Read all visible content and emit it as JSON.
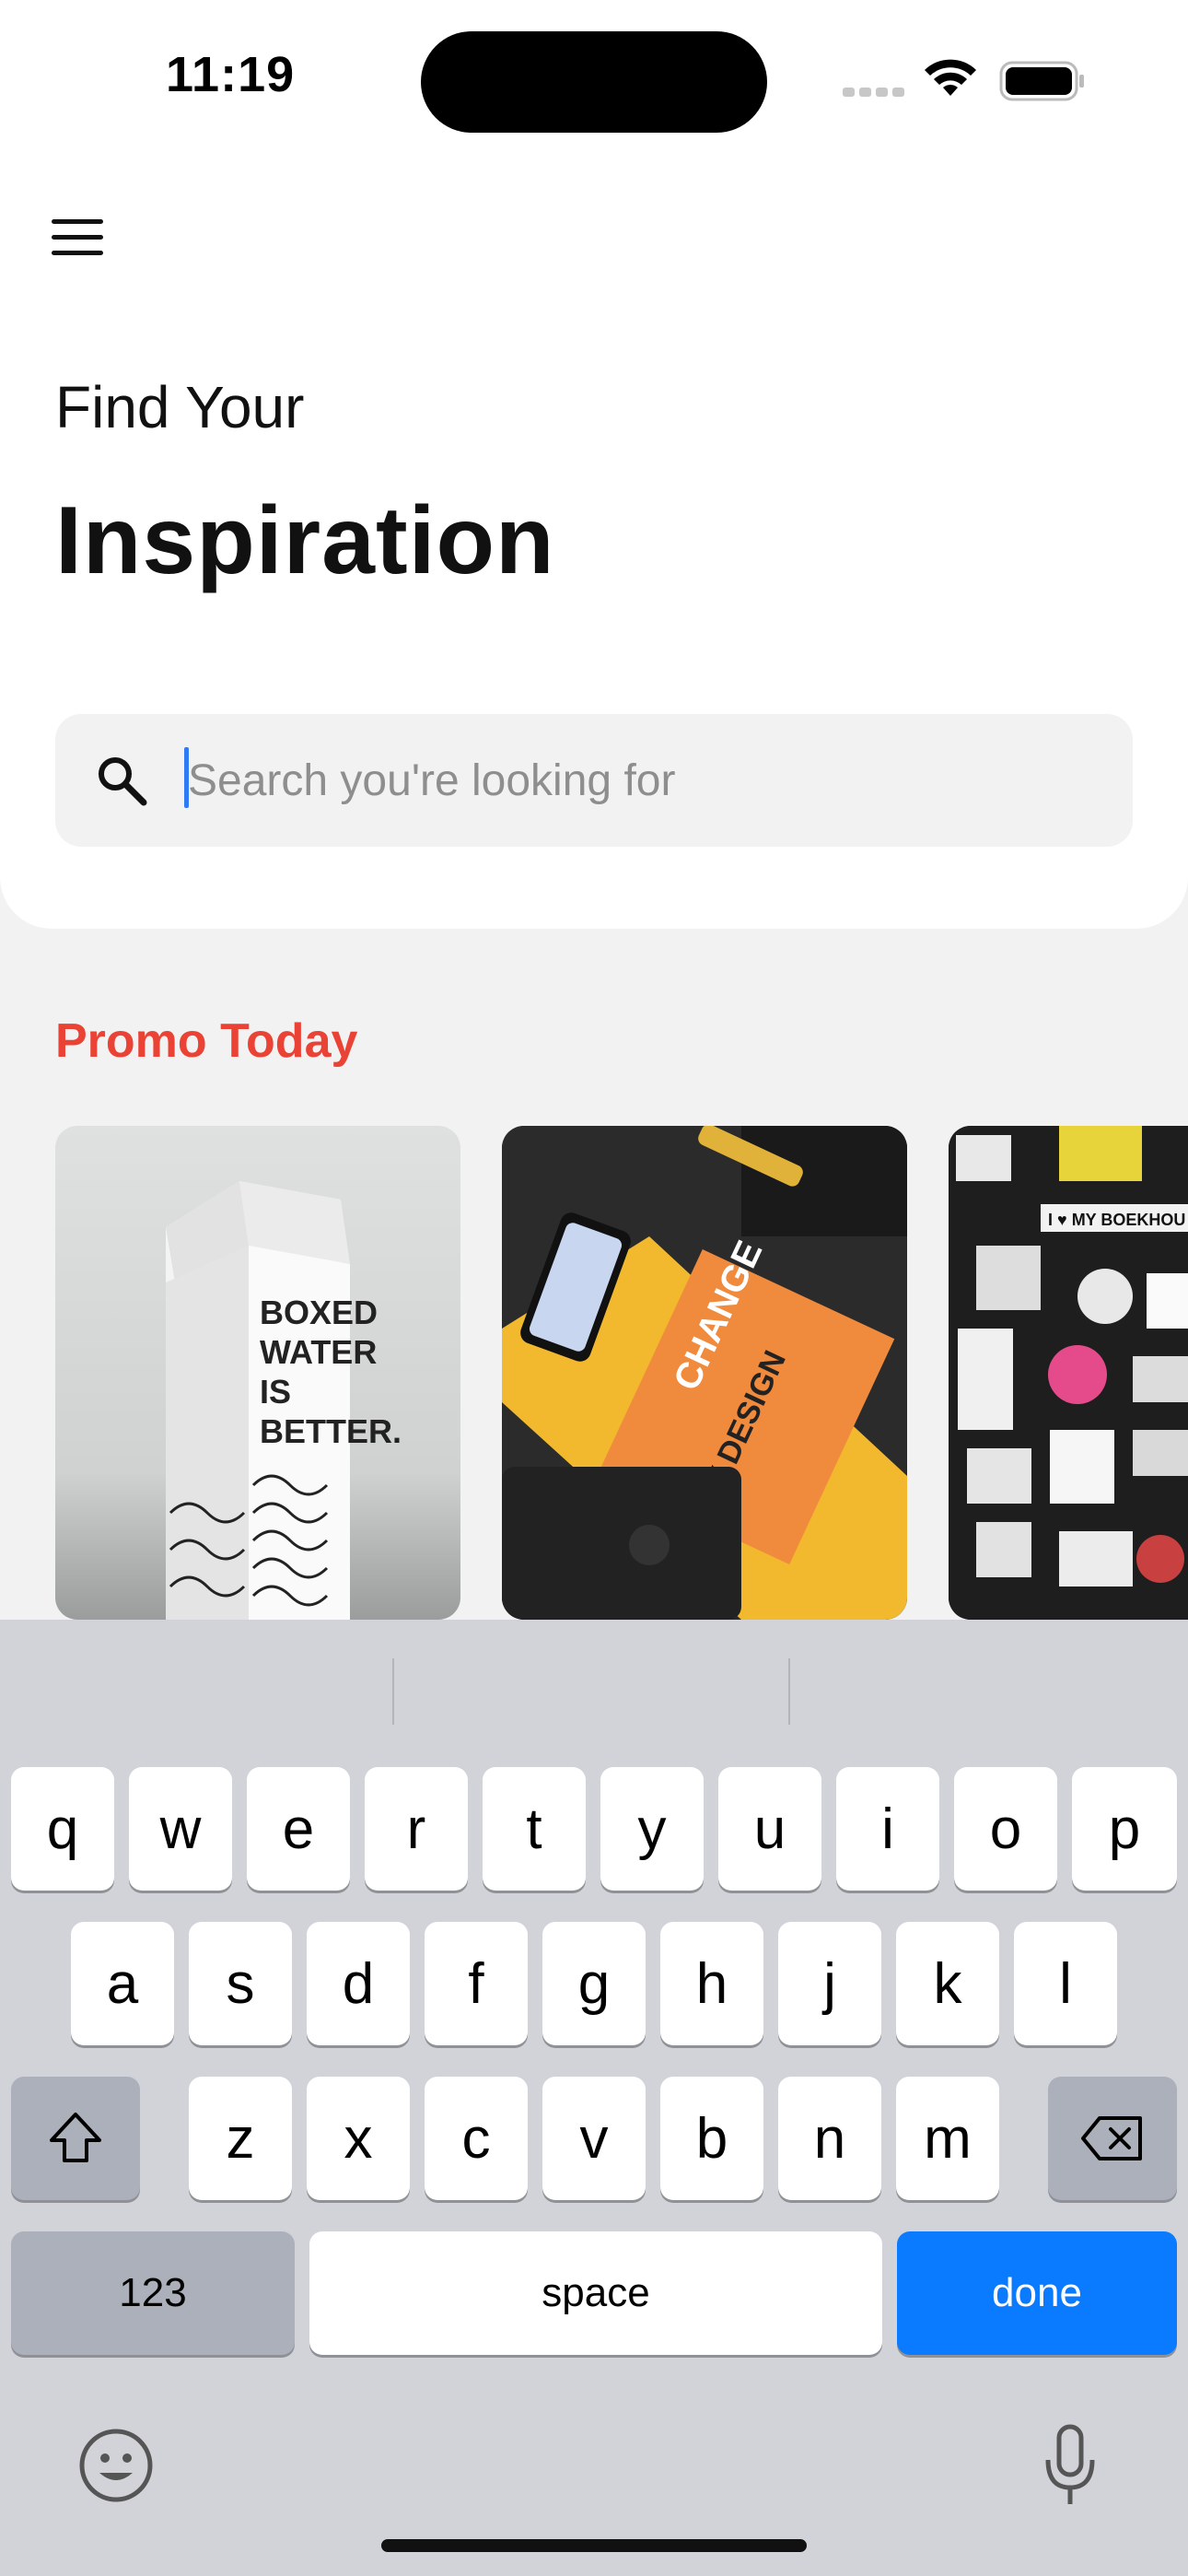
{
  "status_bar": {
    "time": "11:19"
  },
  "header": {
    "subtitle": "Find Your",
    "title": "Inspiration"
  },
  "search": {
    "placeholder": "Search you're looking for",
    "value": ""
  },
  "promo": {
    "title": "Promo Today",
    "cards": [
      {
        "icon": "boxed-water-image",
        "text": [
          "BOXED",
          "WATER",
          "IS",
          "BETTER."
        ]
      },
      {
        "icon": "change-by-design-image",
        "text": [
          "CHANGE",
          "BY DESIGN"
        ]
      },
      {
        "icon": "sticker-wall-image",
        "text": [
          "I ♥ MY BOEKHOU"
        ]
      }
    ]
  },
  "keyboard": {
    "row1": [
      "q",
      "w",
      "e",
      "r",
      "t",
      "y",
      "u",
      "i",
      "o",
      "p"
    ],
    "row2": [
      "a",
      "s",
      "d",
      "f",
      "g",
      "h",
      "j",
      "k",
      "l"
    ],
    "row3": [
      "z",
      "x",
      "c",
      "v",
      "b",
      "n",
      "m"
    ],
    "numbers_label": "123",
    "space_label": "space",
    "done_label": "done",
    "done_color": "#0a7aff"
  },
  "colors": {
    "accent": "#ea4335",
    "caret": "#2f7bf5"
  }
}
